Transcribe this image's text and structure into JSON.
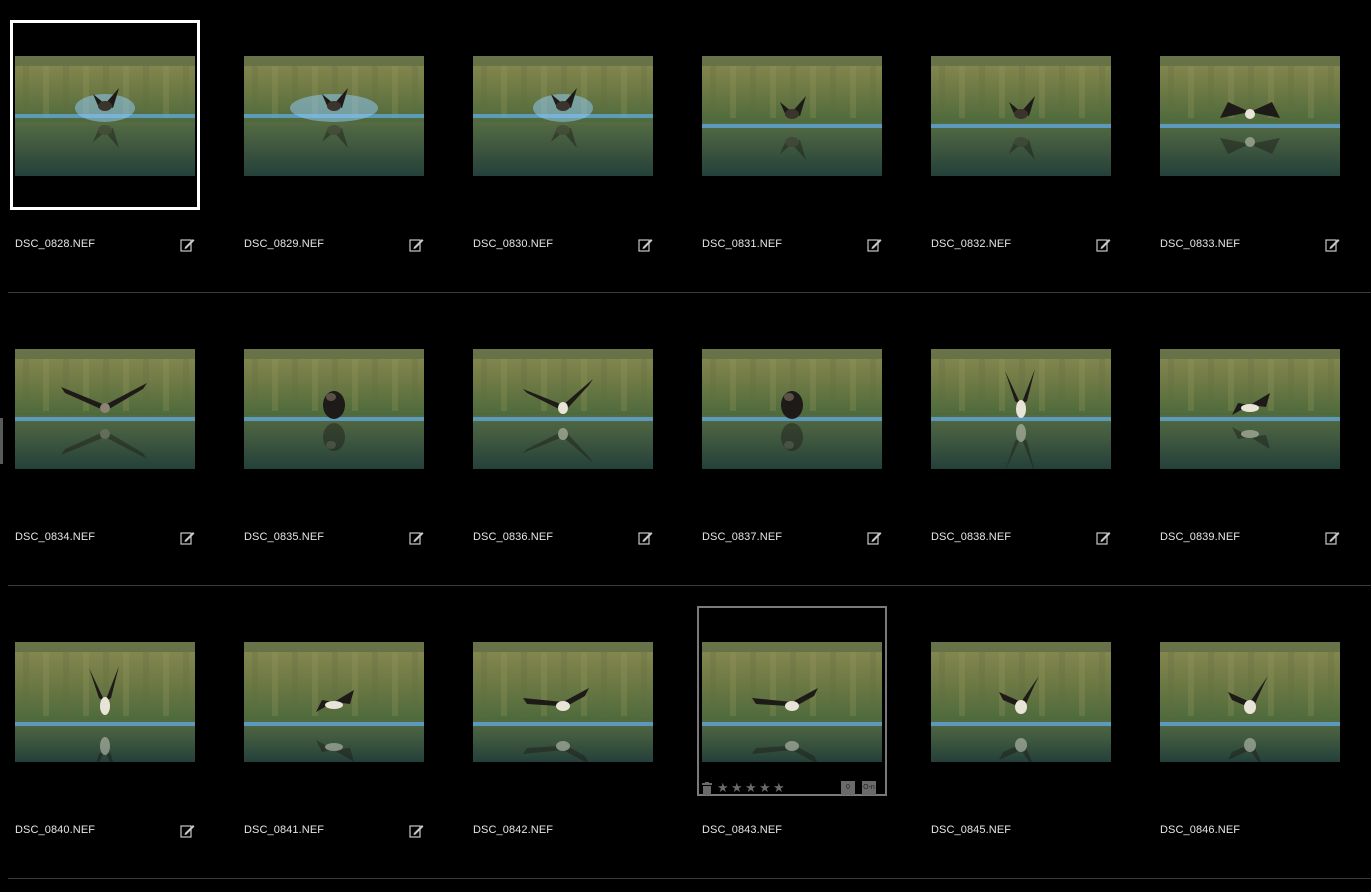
{
  "browser": {
    "selected_index": 0,
    "hovered_index": 15,
    "rating_stars": [
      "★",
      "★",
      "★",
      "★",
      "★"
    ],
    "badges": {
      "label": "0",
      "key": "O-n"
    },
    "items": [
      {
        "filename": "DSC_0828.NEF",
        "edited": true,
        "pose": "splash-up"
      },
      {
        "filename": "DSC_0829.NEF",
        "edited": true,
        "pose": "splash-wide"
      },
      {
        "filename": "DSC_0830.NEF",
        "edited": true,
        "pose": "splash-low"
      },
      {
        "filename": "DSC_0831.NEF",
        "edited": true,
        "pose": "emerge-low"
      },
      {
        "filename": "DSC_0832.NEF",
        "edited": true,
        "pose": "emerge-wings"
      },
      {
        "filename": "DSC_0833.NEF",
        "edited": true,
        "pose": "wings-spread"
      },
      {
        "filename": "DSC_0834.NEF",
        "edited": true,
        "pose": "wings-flat"
      },
      {
        "filename": "DSC_0835.NEF",
        "edited": true,
        "pose": "folded"
      },
      {
        "filename": "DSC_0836.NEF",
        "edited": true,
        "pose": "wings-vee"
      },
      {
        "filename": "DSC_0837.NEF",
        "edited": true,
        "pose": "folded"
      },
      {
        "filename": "DSC_0838.NEF",
        "edited": true,
        "pose": "wings-up"
      },
      {
        "filename": "DSC_0839.NEF",
        "edited": true,
        "pose": "liftoff"
      },
      {
        "filename": "DSC_0840.NEF",
        "edited": true,
        "pose": "wings-up"
      },
      {
        "filename": "DSC_0841.NEF",
        "edited": true,
        "pose": "liftoff-low"
      },
      {
        "filename": "DSC_0842.NEF",
        "edited": false,
        "pose": "flight"
      },
      {
        "filename": "DSC_0843.NEF",
        "edited": false,
        "pose": "flight"
      },
      {
        "filename": "DSC_0845.NEF",
        "edited": false,
        "pose": "flight-up"
      },
      {
        "filename": "DSC_0846.NEF",
        "edited": false,
        "pose": "flight-up"
      }
    ]
  },
  "colors": {
    "background": "#000000",
    "selected_border": "#ffffff",
    "hover_border": "#7a7a7a",
    "divider": "#3a3a3a",
    "filename_text": "#e6e6e6",
    "icon": "#c8c8c8"
  }
}
